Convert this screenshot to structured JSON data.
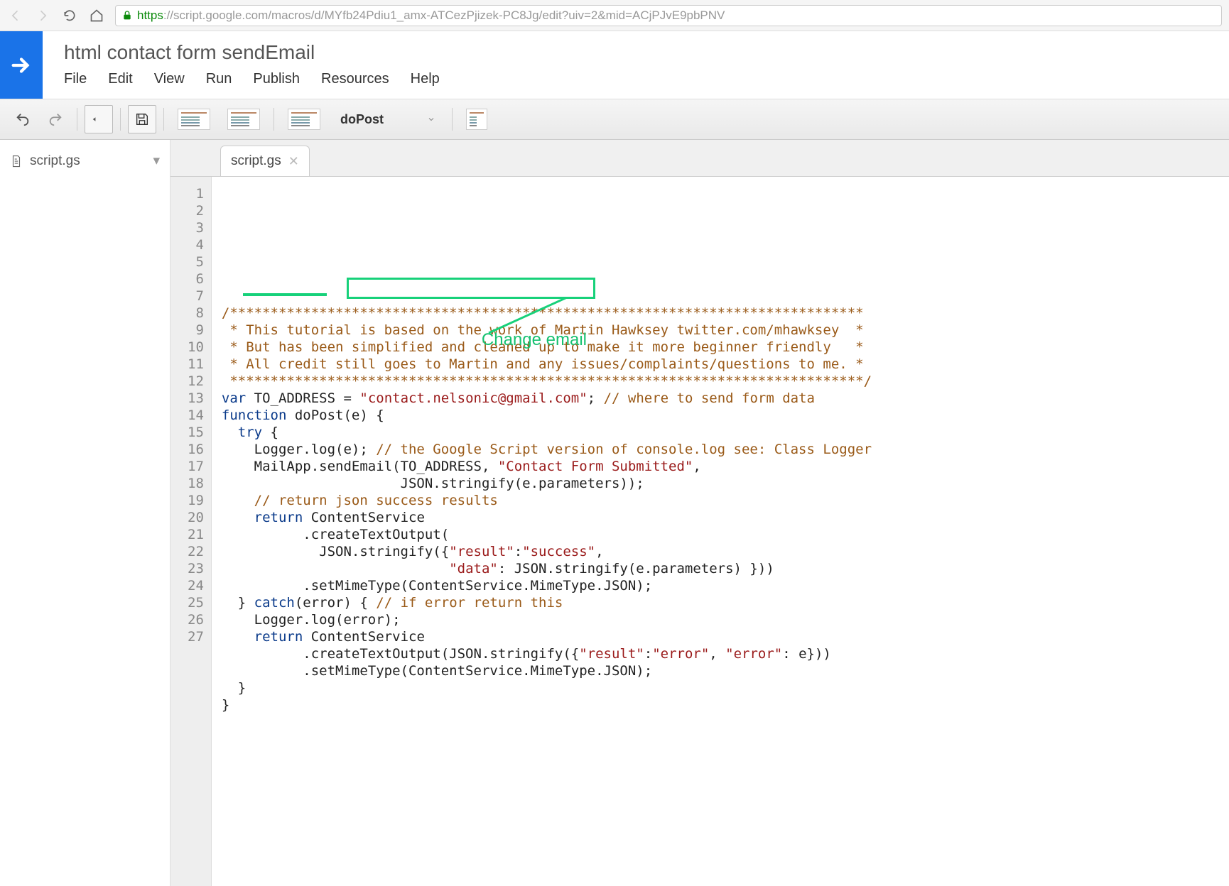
{
  "browser": {
    "url_secure_part": "https",
    "url_rest": "://script.google.com/macros/d/MYfb24Pdiu1_amx-ATCezPjizek-PC8Jg/edit?uiv=2&mid=ACjPJvE9pbPNV"
  },
  "app": {
    "title": "html contact form sendEmail",
    "menus": [
      "File",
      "Edit",
      "View",
      "Run",
      "Publish",
      "Resources",
      "Help"
    ]
  },
  "toolbar": {
    "selected_function": "doPost"
  },
  "sidebar": {
    "file": "script.gs"
  },
  "tab": {
    "label": "script.gs"
  },
  "annotation": {
    "label": "Change email"
  },
  "code": {
    "lines": [
      {
        "n": 1,
        "tokens": [
          [
            "com",
            "/******************************************************************************"
          ]
        ]
      },
      {
        "n": 2,
        "tokens": [
          [
            "com",
            " * This tutorial is based on the work of Martin Hawksey twitter.com/mhawksey  *"
          ]
        ]
      },
      {
        "n": 3,
        "tokens": [
          [
            "com",
            " * But has been simplified and cleaned up to make it more beginner friendly   *"
          ]
        ]
      },
      {
        "n": 4,
        "tokens": [
          [
            "com",
            " * All credit still goes to Martin and any issues/complaints/questions to me. *"
          ]
        ]
      },
      {
        "n": 5,
        "tokens": [
          [
            "com",
            " ******************************************************************************/"
          ]
        ]
      },
      {
        "n": 6,
        "tokens": [
          [
            "plain",
            ""
          ]
        ]
      },
      {
        "n": 7,
        "tokens": [
          [
            "kw",
            "var"
          ],
          [
            "plain",
            " TO_ADDRESS = "
          ],
          [
            "str",
            "\"contact.nelsonic@gmail.com\""
          ],
          [
            "plain",
            "; "
          ],
          [
            "com",
            "// where to send form data"
          ]
        ]
      },
      {
        "n": 8,
        "tokens": [
          [
            "plain",
            ""
          ]
        ]
      },
      {
        "n": 9,
        "tokens": [
          [
            "kw",
            "function"
          ],
          [
            "plain",
            " doPost(e) {"
          ]
        ]
      },
      {
        "n": 10,
        "tokens": [
          [
            "plain",
            ""
          ]
        ]
      },
      {
        "n": 11,
        "tokens": [
          [
            "plain",
            "  "
          ],
          [
            "kw",
            "try"
          ],
          [
            "plain",
            " {"
          ]
        ]
      },
      {
        "n": 12,
        "tokens": [
          [
            "plain",
            "    Logger.log(e); "
          ],
          [
            "com",
            "// the Google Script version of console.log see: Class Logger"
          ]
        ]
      },
      {
        "n": 13,
        "tokens": [
          [
            "plain",
            "    MailApp.sendEmail(TO_ADDRESS, "
          ],
          [
            "str",
            "\"Contact Form Submitted\""
          ],
          [
            "plain",
            ","
          ]
        ]
      },
      {
        "n": 14,
        "tokens": [
          [
            "plain",
            "                      JSON.stringify(e.parameters));"
          ]
        ]
      },
      {
        "n": 15,
        "tokens": [
          [
            "plain",
            "    "
          ],
          [
            "com",
            "// return json success results"
          ]
        ]
      },
      {
        "n": 16,
        "tokens": [
          [
            "plain",
            "    "
          ],
          [
            "kw",
            "return"
          ],
          [
            "plain",
            " ContentService"
          ]
        ]
      },
      {
        "n": 17,
        "tokens": [
          [
            "plain",
            "          .createTextOutput("
          ]
        ]
      },
      {
        "n": 18,
        "tokens": [
          [
            "plain",
            "            JSON.stringify({"
          ],
          [
            "str",
            "\"result\""
          ],
          [
            "plain",
            ":"
          ],
          [
            "str",
            "\"success\""
          ],
          [
            "plain",
            ","
          ]
        ]
      },
      {
        "n": 19,
        "tokens": [
          [
            "plain",
            "                            "
          ],
          [
            "str",
            "\"data\""
          ],
          [
            "plain",
            ": JSON.stringify(e.parameters) }))"
          ]
        ]
      },
      {
        "n": 20,
        "tokens": [
          [
            "plain",
            "          .setMimeType(ContentService.MimeType.JSON);"
          ]
        ]
      },
      {
        "n": 21,
        "tokens": [
          [
            "plain",
            "  } "
          ],
          [
            "kw",
            "catch"
          ],
          [
            "plain",
            "(error) { "
          ],
          [
            "com",
            "// if error return this"
          ]
        ]
      },
      {
        "n": 22,
        "tokens": [
          [
            "plain",
            "    Logger.log(error);"
          ]
        ]
      },
      {
        "n": 23,
        "tokens": [
          [
            "plain",
            "    "
          ],
          [
            "kw",
            "return"
          ],
          [
            "plain",
            " ContentService"
          ]
        ]
      },
      {
        "n": 24,
        "tokens": [
          [
            "plain",
            "          .createTextOutput(JSON.stringify({"
          ],
          [
            "str",
            "\"result\""
          ],
          [
            "plain",
            ":"
          ],
          [
            "str",
            "\"error\""
          ],
          [
            "plain",
            ", "
          ],
          [
            "str",
            "\"error\""
          ],
          [
            "plain",
            ": e}))"
          ]
        ]
      },
      {
        "n": 25,
        "tokens": [
          [
            "plain",
            "          .setMimeType(ContentService.MimeType.JSON);"
          ]
        ]
      },
      {
        "n": 26,
        "tokens": [
          [
            "plain",
            "  }"
          ]
        ]
      },
      {
        "n": 27,
        "tokens": [
          [
            "plain",
            "}"
          ]
        ]
      }
    ]
  }
}
